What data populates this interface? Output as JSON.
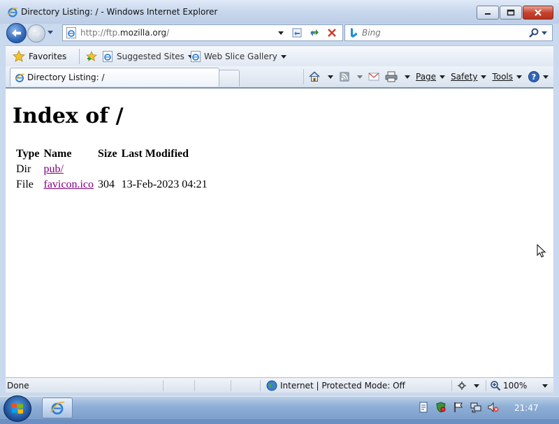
{
  "window": {
    "title": "Directory Listing: / - Windows Internet Explorer"
  },
  "nav": {
    "address": {
      "prefix": "http://ftp.",
      "domain": "mozilla.org",
      "suffix": "/"
    },
    "search_placeholder": "Bing"
  },
  "favorites_bar": {
    "favorites_label": "Favorites",
    "suggested_sites": "Suggested Sites",
    "web_slice_gallery": "Web Slice Gallery"
  },
  "tab": {
    "label": "Directory Listing: /"
  },
  "command_bar": {
    "page": "Page",
    "safety": "Safety",
    "tools": "Tools"
  },
  "page": {
    "heading": "Index of /",
    "columns": [
      "Type",
      "Name",
      "Size",
      "Last Modified"
    ],
    "rows": [
      {
        "type": "Dir",
        "name": "pub/",
        "size": "",
        "modified": ""
      },
      {
        "type": "File",
        "name": "favicon.ico",
        "size": "304",
        "modified": "13-Feb-2023 04:21"
      }
    ]
  },
  "status": {
    "text": "Done",
    "zone": "Internet | Protected Mode: Off",
    "zoom": "100%"
  },
  "taskbar": {
    "clock": "21:47"
  },
  "colors": {
    "link_visited": "#800080",
    "title_gradient_top": "#dfe9f7",
    "close_button": "#c7432d"
  }
}
